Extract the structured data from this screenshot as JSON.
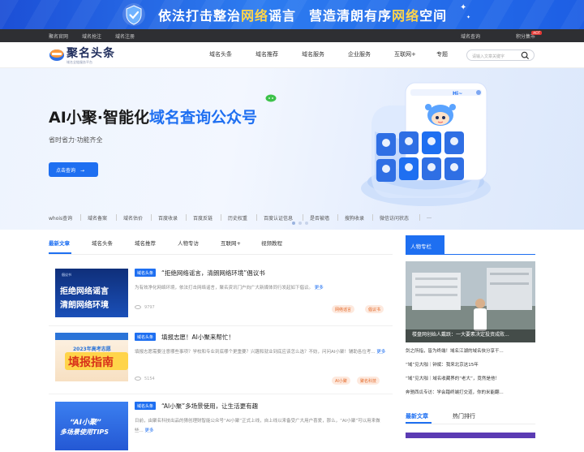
{
  "banner": {
    "text_a": "依法打击整治",
    "text_b": "网络",
    "text_c": "谣言",
    "text_d": "营造清朗有序",
    "text_e": "网络",
    "text_f": "空间"
  },
  "topbar": {
    "left_links": [
      "聚名官网",
      "域名抢注",
      "域名注册"
    ],
    "right_links": [
      "域名查询",
      "积分集市"
    ],
    "badge": "HOT"
  },
  "header": {
    "logo_name": "聚名头条",
    "logo_sub": "域名全链服务平台",
    "nav": [
      "域名头条",
      "域名推荐",
      "域名服务",
      "企业服务",
      "互联网+",
      "专题"
    ],
    "search_placeholder": "请输入文章关键字"
  },
  "hero": {
    "title_a": "AI小聚·智能化",
    "title_b": "域名查询公众号",
    "subtitle": "省时省力·功能齐全",
    "button": "点击查询",
    "quick_links": [
      "whois查询",
      "域名备案",
      "域名估价",
      "百度收录",
      "百度反链",
      "历史权重",
      "百度认证信息",
      "是否被墙",
      "搜狗收录",
      "微信访问状态",
      "…"
    ]
  },
  "tabs": [
    "最新文章",
    "域名头条",
    "域名推荐",
    "人物专访",
    "互联网+",
    "视频教程"
  ],
  "articles": [
    {
      "tag": "域名头条",
      "title": "“拒绝网络谣言，清朗网络环境”倡议书",
      "desc": "为有效净化网络环境，依法打击网络谣言，聚名资讯门户向广大新媒体同行发起如下倡议。",
      "more": "更多",
      "views": "9797",
      "tags": [
        "网络谣言",
        "倡议书"
      ],
      "thumb_line1": "拒绝网络谣言",
      "thumb_line2": "清朗网络环境",
      "thumb_small": "倡议书"
    },
    {
      "tag": "域名头条",
      "title": "填报志愿！AI小聚来帮忙！",
      "desc": "填报志愿需要注意哪些事项？学校和专业到底哪个更重要？兴趣和就业到底应该怎么选？不妨，问问AI小聚！辅助各位考...",
      "more": "更多",
      "views": "5154",
      "tags": [
        "AI小聚",
        "聚名科技"
      ],
      "thumb_line1": "2023年高考志愿",
      "thumb_line2": "填报指南"
    },
    {
      "tag": "域名头条",
      "title": "“AI小聚”多场景使用，让生活更有趣",
      "desc": "日前，由聚名科技出品的猜创理财智能公众号“AI小聚”正式上线，自上线以来备受广大用户喜爱，那么，“AI小聚”可以用来做些...",
      "more": "更多",
      "thumb_line1": "“AI小聚”",
      "thumb_line2": "多场景使用TIPS"
    }
  ],
  "sidebar": {
    "tab": "人物专栏",
    "image_caption": "楼盘网创始人戴跃：一大要素决定投资成败...",
    "list": [
      "剑之所指，皆为终端！域名江湖的域名侠分享干...",
      "“域”见大咖｜钟斌：我来北京这15年",
      "“域”见大咖｜域名收藏界的“老大”，竟然是他！",
      "奔驰西瓜专访：学会踏终端打交道，你的米能翻..."
    ],
    "tabs2": [
      "最新文章",
      "热门排行"
    ]
  },
  "colors": {
    "accent": "#1e6ff1",
    "banner": "#2d7cf0",
    "topbar": "#2e2f33",
    "pill_bg": "#fde9de",
    "pill_text": "#e46a2a"
  }
}
